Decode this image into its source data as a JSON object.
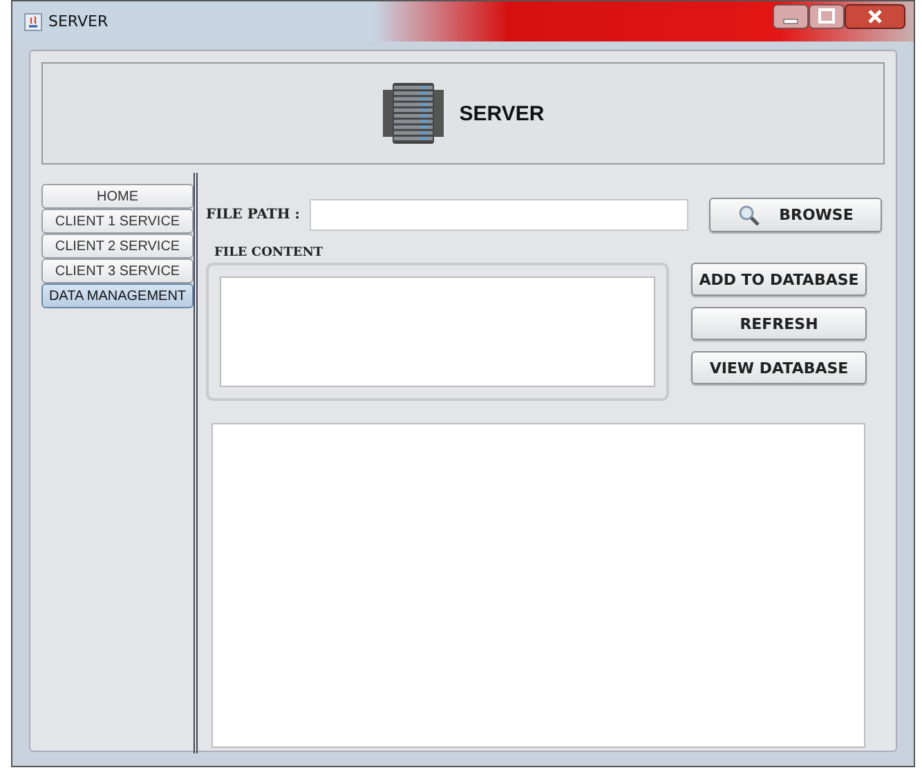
{
  "window": {
    "title": "SERVER"
  },
  "header": {
    "title": "SERVER"
  },
  "tabs": [
    {
      "label": "HOME",
      "selected": false
    },
    {
      "label": "CLIENT 1 SERVICE",
      "selected": false
    },
    {
      "label": "CLIENT 2 SERVICE",
      "selected": false
    },
    {
      "label": "CLIENT 3 SERVICE",
      "selected": false
    },
    {
      "label": "DATA MANAGEMENT",
      "selected": true
    }
  ],
  "file_path": {
    "label": "FILE PATH :"
  },
  "browse_button": "BROWSE",
  "file_content": {
    "label": "FILE CONTENT"
  },
  "buttons": [
    "ADD TO DATABASE",
    "REFRESH",
    "VIEW DATABASE"
  ]
}
